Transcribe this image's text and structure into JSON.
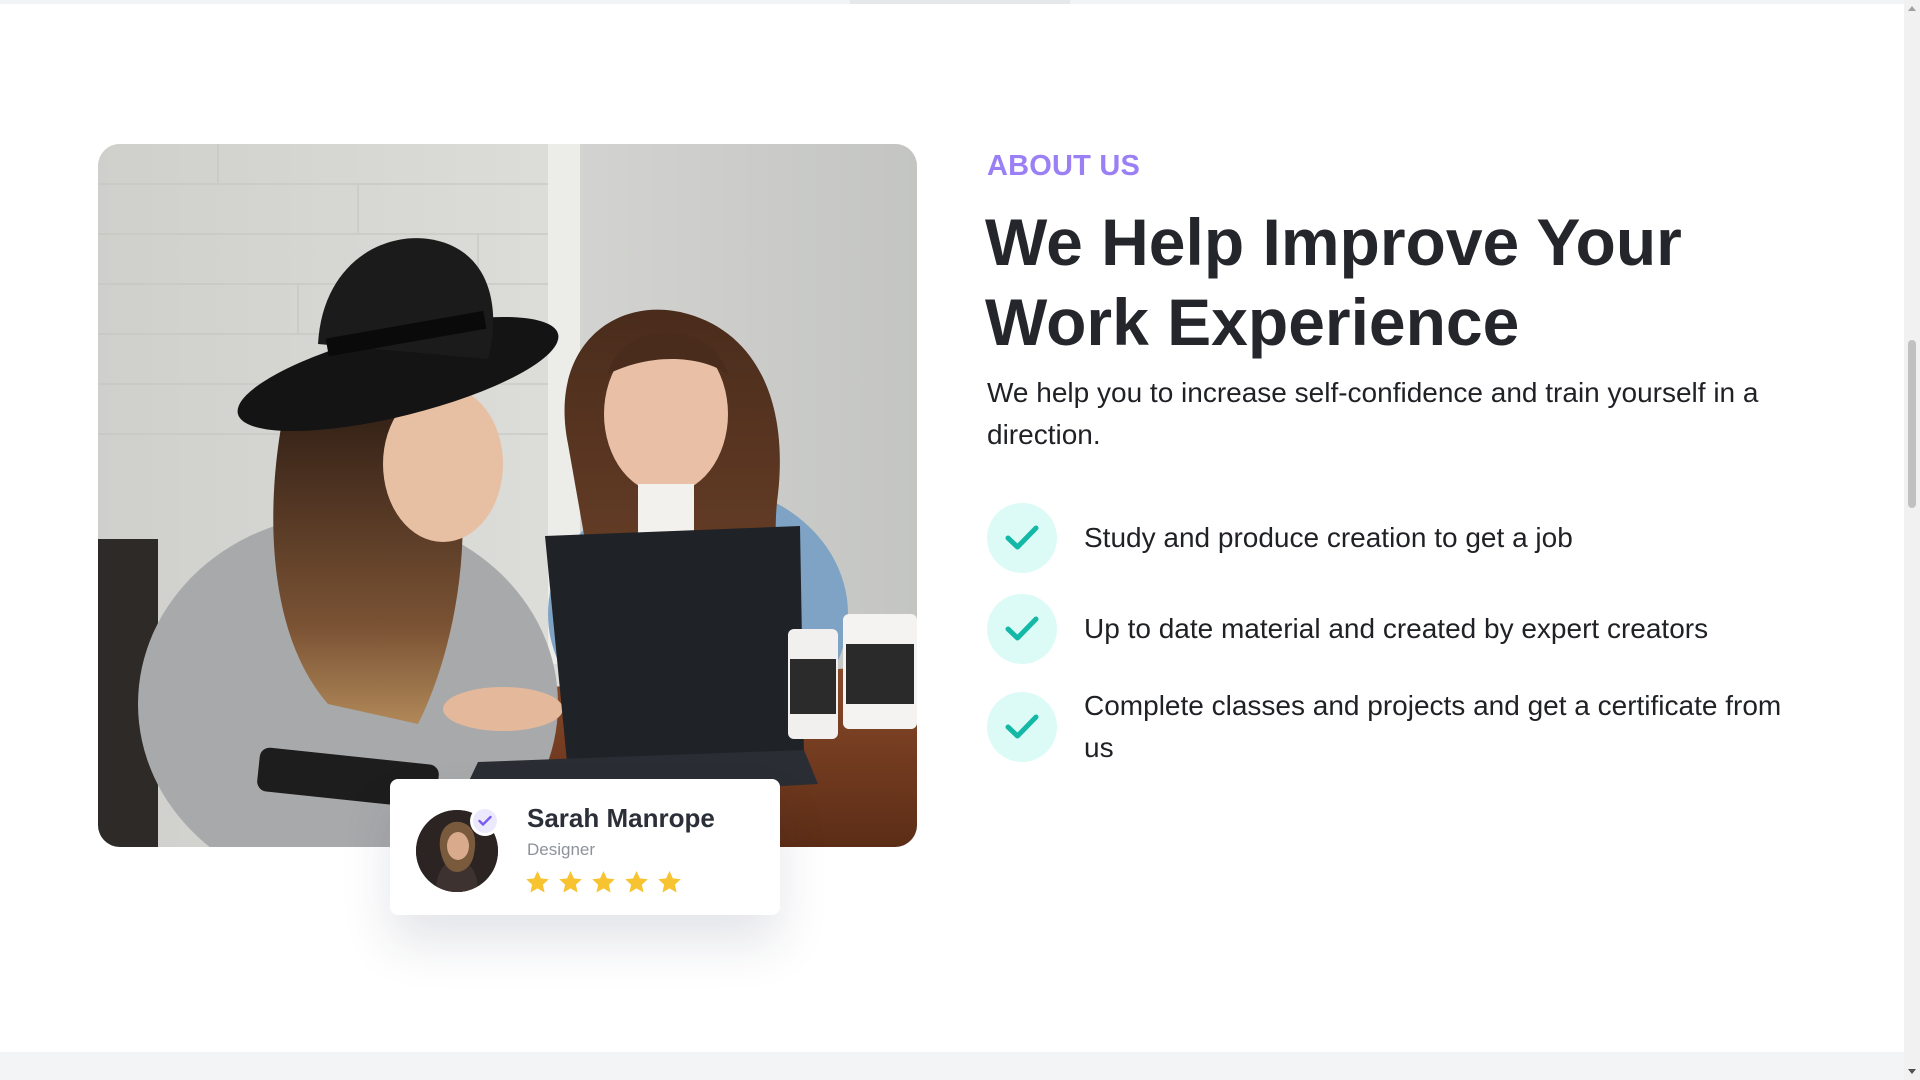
{
  "about": {
    "eyebrow": "ABOUT US",
    "headline_line1": "We Help Improve Your",
    "headline_line2": "Work Experience",
    "lead": "We help you to increase self-confidence and train yourself in a direction."
  },
  "features": [
    {
      "text": "Study and produce creation to get a job",
      "icon": "check-icon"
    },
    {
      "text": "Up to date material and created by expert creators",
      "icon": "check-icon"
    },
    {
      "text": "Complete classes and projects and get a certificate from us",
      "icon": "check-icon"
    }
  ],
  "profile_card": {
    "name": "Sarah Manrope",
    "role": "Designer",
    "rating": 5,
    "rating_max": 5,
    "badge_icon": "verified-check-icon"
  },
  "photo": {
    "subject": "two-women-at-laptop-photo"
  },
  "colors": {
    "accent_purple": "#9b80f5",
    "check_teal": "#14b8a6",
    "check_bg": "#dcfbf6",
    "star_yellow": "#f7c331",
    "heading": "#24262b"
  }
}
